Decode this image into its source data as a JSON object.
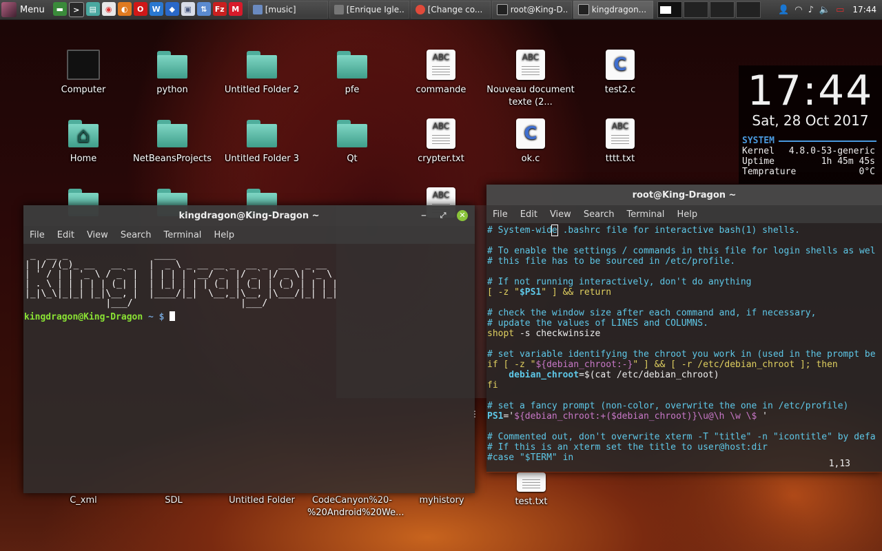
{
  "panel": {
    "menu_label": "Menu",
    "tasks": [
      {
        "label": "[music]",
        "color": "#6a8ac0"
      },
      {
        "label": "[Enrique Igle...",
        "color": "#555"
      },
      {
        "label": "[Change co...",
        "color": "#e04a3a"
      },
      {
        "label": "root@King-D...",
        "color": "#222"
      },
      {
        "label": "kingdragon...",
        "color": "#222"
      }
    ],
    "clock": "17:44"
  },
  "desktop": {
    "icons": [
      {
        "label": "Computer",
        "type": "monitor"
      },
      {
        "label": "python",
        "type": "folder"
      },
      {
        "label": "Untitled Folder 2",
        "type": "folder"
      },
      {
        "label": "pfe",
        "type": "folder"
      },
      {
        "label": "commande",
        "type": "abc"
      },
      {
        "label": "Nouveau document texte (2...",
        "type": "abc"
      },
      {
        "label": "test2.c",
        "type": "c"
      },
      {
        "label": "Home",
        "type": "home"
      },
      {
        "label": "NetBeansProjects",
        "type": "folder"
      },
      {
        "label": "Untitled Folder 3",
        "type": "folder"
      },
      {
        "label": "Qt",
        "type": "folder"
      },
      {
        "label": "crypter.txt",
        "type": "abc"
      },
      {
        "label": "ok.c",
        "type": "c"
      },
      {
        "label": "tttt.txt",
        "type": "abc"
      },
      {
        "label": "C_xml",
        "type": "label"
      },
      {
        "label": "SDL",
        "type": "label"
      },
      {
        "label": "Untitled Folder",
        "type": "label"
      },
      {
        "label": "CodeCanyon%20-%20Android%20We...",
        "type": "label"
      },
      {
        "label": "myhistory",
        "type": "label"
      },
      {
        "label": "test.txt",
        "type": "label"
      }
    ]
  },
  "conky": {
    "time": "17:44",
    "date": "Sat, 28 Oct 2017",
    "section": "SYSTEM",
    "rows": [
      {
        "key": "Kernel",
        "value": "4.8.0-53-generic"
      },
      {
        "key": "Uptime",
        "value": "1h 45m 45s"
      },
      {
        "key": "Temprature",
        "value": "0°C"
      }
    ]
  },
  "term1": {
    "title": "kingdragon@King-Dragon ~",
    "menu": [
      "File",
      "Edit",
      "View",
      "Search",
      "Terminal",
      "Help"
    ],
    "ascii": " _  __ _                ____                              \n| |/ /(_)_ __   __ _   |  _ \\ _ __ __ _  __ _  ___  _ __  \n| ' / | | '_ \\ / _` |  | | | | '__/ _` |/ _` |/ _ \\| '_ \\ \n| . \\ | | | | | (_| |  | |_| | | | (_| | (_| | (_) | | | |\n|_|\\_\\|_|_| |_|\\__, |  |____/|_|  \\__,_|\\__, |\\___/|_| |_|\n               |___/                    |___/               ",
    "prompt_user": "kingdragon@King-Dragon",
    "prompt_path": "~ $"
  },
  "term2": {
    "title": "root@King-Dragon ~",
    "menu": [
      "File",
      "Edit",
      "View",
      "Search",
      "Terminal",
      "Help"
    ],
    "ruler": "1,13",
    "lines": {
      "l1a": "# System-wid",
      "l1b": "e",
      "l1c": " .bashrc file for interactive bash(1) shells.",
      "l2": "# To enable the settings / commands in this file for login shells as wel",
      "l3": "# this file has to be sourced in /etc/profile.",
      "l4": "# If not running interactively, don't do anything",
      "l5a": "[ -z \"",
      "l5b": "$PS1",
      "l5c": "\" ] && return",
      "l6": "# check the window size after each command and, if necessary,",
      "l7": "# update the values of LINES and COLUMNS.",
      "l8a": "shopt",
      "l8b": " -s checkwinsize",
      "l9": "# set variable identifying the chroot you work in (used in the prompt be",
      "l10a": "if",
      "l10b": " [ -z \"",
      "l10c": "${debian_chroot:-}",
      "l10d": "\" ] && [ -r /etc/debian_chroot ]; ",
      "l10e": "then",
      "l11a": "    debian_chroot",
      "l11b": "=$(cat /etc/debian_chroot)",
      "l12": "fi",
      "l13": "# set a fancy prompt (non-color, overwrite the one in /etc/profile)",
      "l14a": "PS1",
      "l14b": "='",
      "l14c": "${debian_chroot:+($debian_chroot)}\\u@\\h \\w \\$ ",
      "l14d": "'",
      "l15": "# Commented out, don't overwrite xterm -T \"title\" -n \"icontitle\" by defa",
      "l16": "# If this is an xterm set the title to user@host:dir",
      "l17": "#case \"$TERM\" in"
    }
  }
}
